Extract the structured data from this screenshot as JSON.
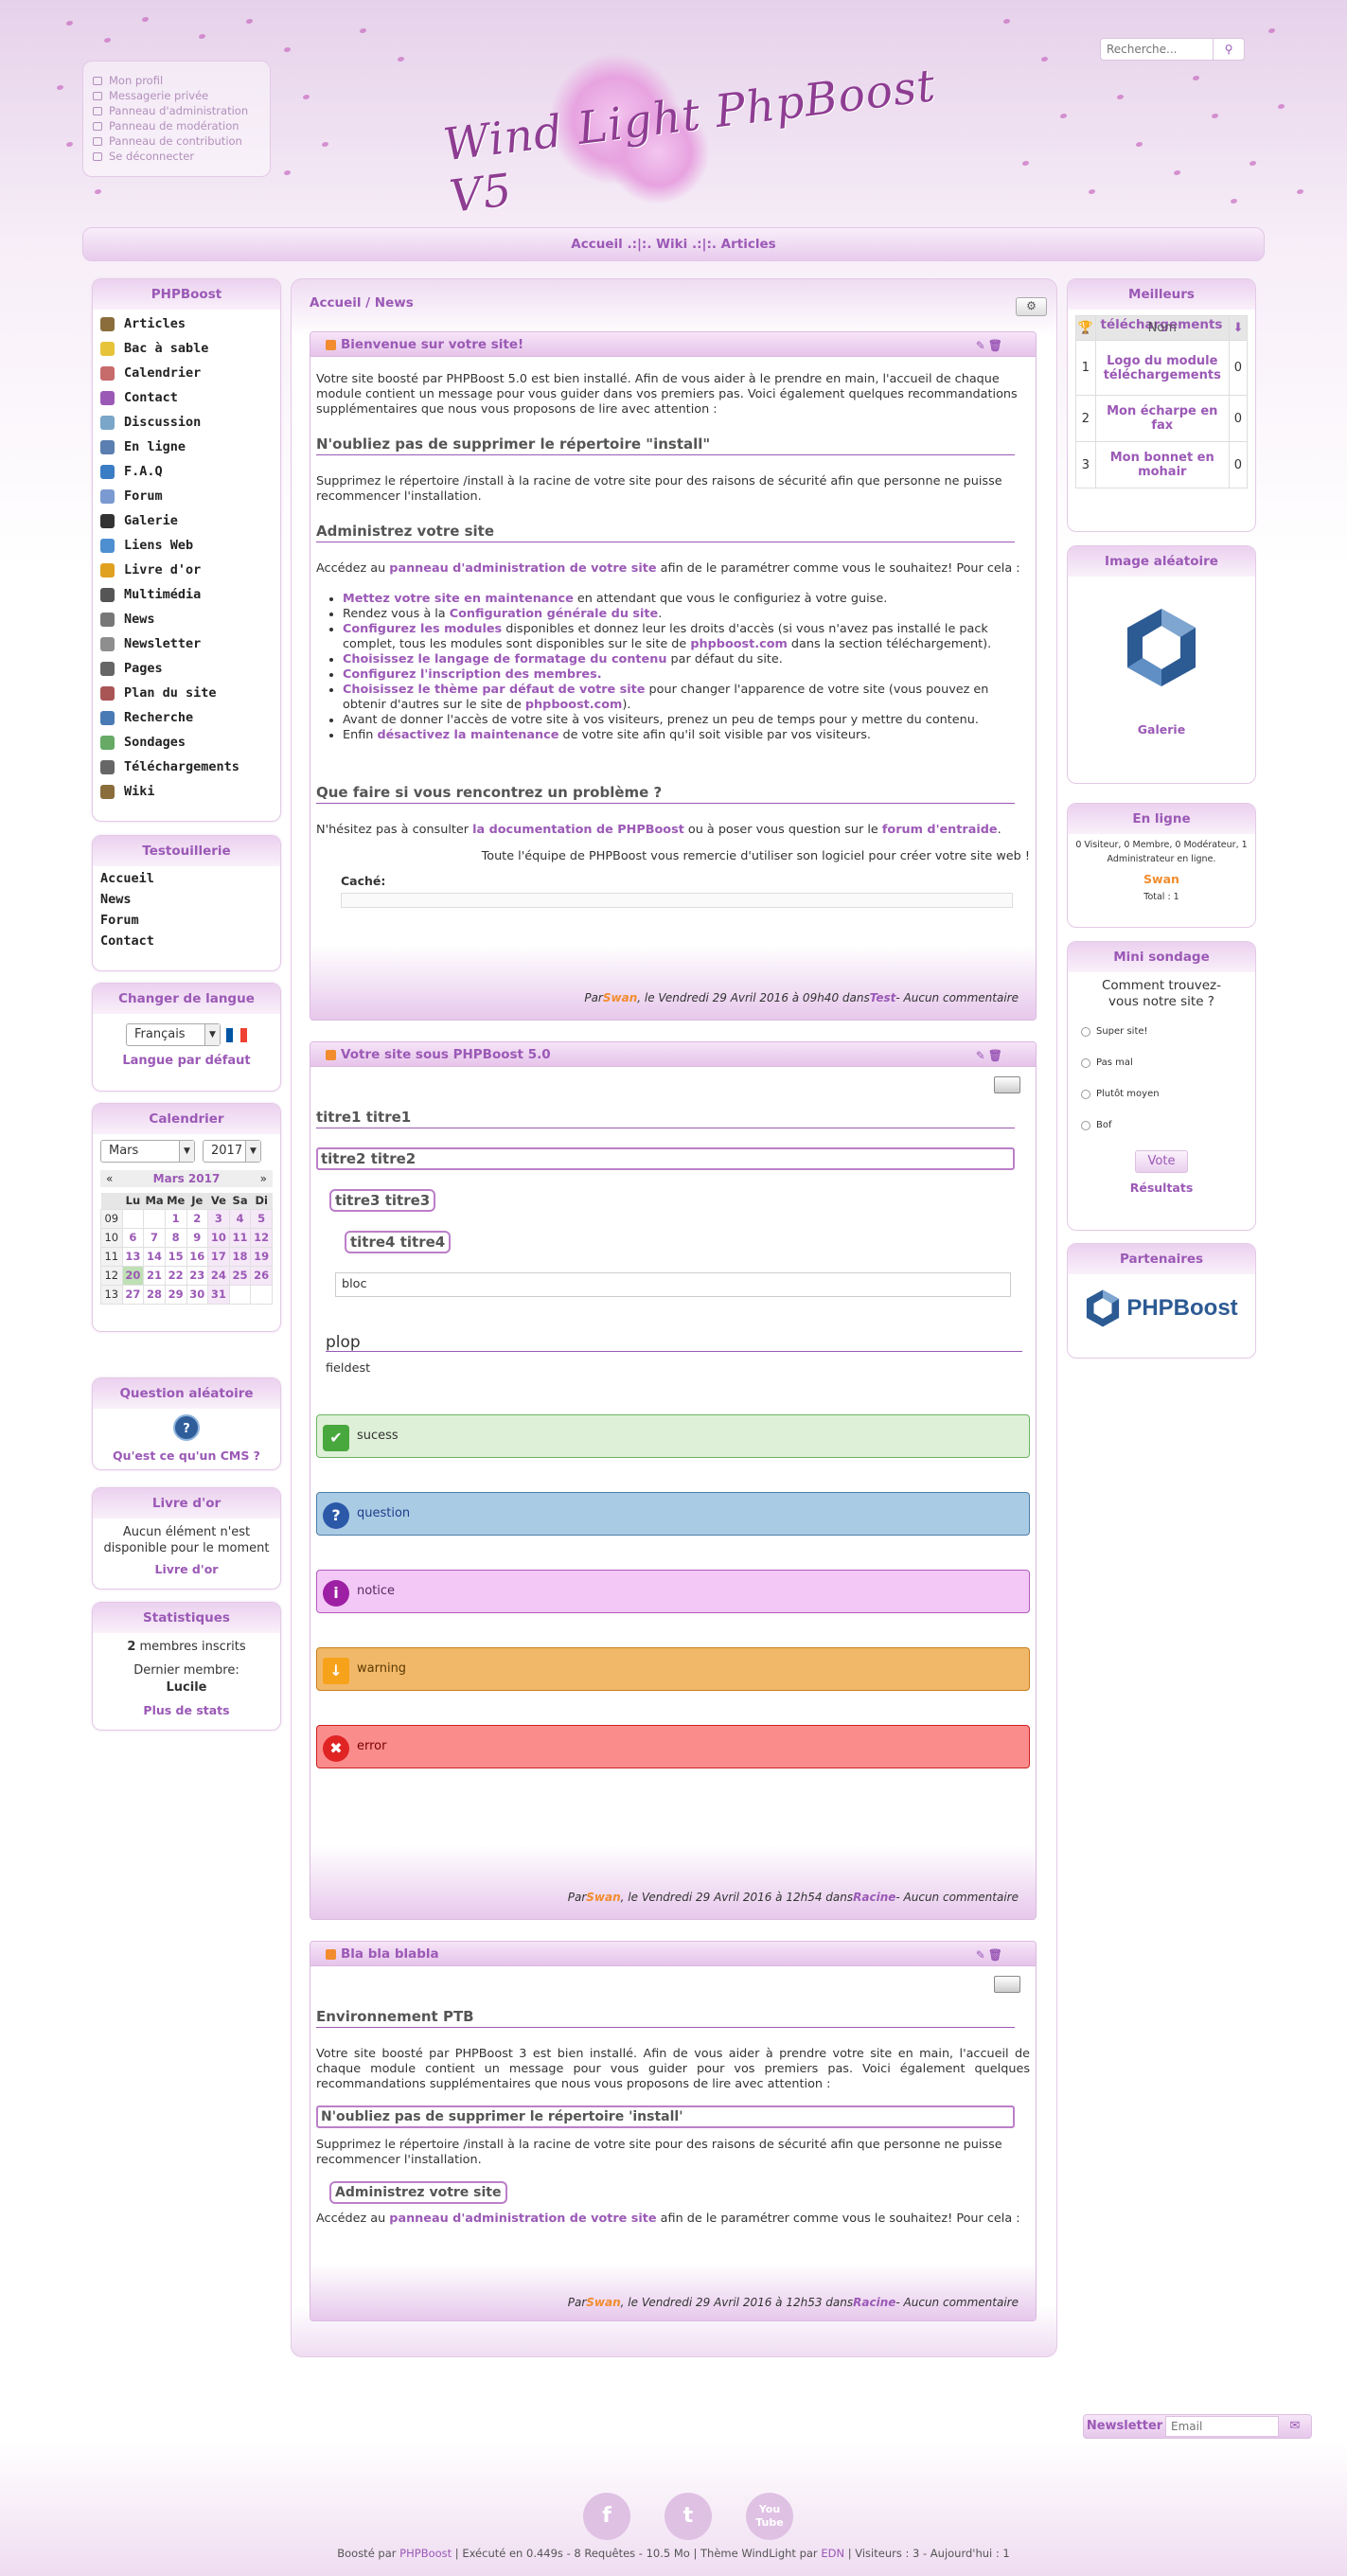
{
  "user_menu": [
    "Mon profil",
    "Messagerie privée",
    "Panneau d'administration",
    "Panneau de modération",
    "Panneau de contribution",
    "Se déconnecter"
  ],
  "logo_text": "Wind Light PhpBoost V5",
  "search": {
    "placeholder": "Recherche...",
    "icon": "search-icon"
  },
  "topbar": "Accueil .:|:. Wiki .:|:. Articles",
  "left": {
    "phpboost_title": "PHPBoost",
    "nav": [
      "Articles",
      "Bac à sable",
      "Calendrier",
      "Contact",
      "Discussion",
      "En ligne",
      "F.A.Q",
      "Forum",
      "Galerie",
      "Liens Web",
      "Livre d'or",
      "Multimédia",
      "News",
      "Newsletter",
      "Pages",
      "Plan du site",
      "Recherche",
      "Sondages",
      "Téléchargements",
      "Wiki"
    ],
    "testouillerie_title": "Testouillerie",
    "testouillerie": [
      "Accueil",
      "News",
      "Forum",
      "Contact"
    ],
    "lang_title": "Changer de langue",
    "lang_value": "Français",
    "lang_default": "Langue par défaut",
    "cal_title": "Calendrier",
    "cal_month": "Mars",
    "cal_year": "2017",
    "cal_prev": "«",
    "cal_next": "»",
    "cal_label": "Mars 2017",
    "cal_days": [
      "Lu",
      "Ma",
      "Me",
      "Je",
      "Ve",
      "Sa",
      "Di"
    ],
    "cal_weeks": [
      [
        "09",
        "",
        "",
        "1",
        "2",
        "3",
        "4",
        "5"
      ],
      [
        "10",
        "6",
        "7",
        "8",
        "9",
        "10",
        "11",
        "12"
      ],
      [
        "11",
        "13",
        "14",
        "15",
        "16",
        "17",
        "18",
        "19"
      ],
      [
        "12",
        "20",
        "21",
        "22",
        "23",
        "24",
        "25",
        "26"
      ],
      [
        "13",
        "27",
        "28",
        "29",
        "30",
        "31",
        "",
        ""
      ]
    ],
    "q_title": "Question aléatoire",
    "q_text": "Qu'est ce qu'un CMS ?",
    "guest_title": "Livre d'or",
    "guest_text": "Aucun élément n'est disponible pour le moment",
    "guest_link": "Livre d'or",
    "stats_title": "Statistiques",
    "stats_members_count": "2",
    "stats_members_label": "membres inscrits",
    "stats_last_label": "Dernier membre:",
    "stats_last_name": "Lucile",
    "stats_more": "Plus de stats"
  },
  "center": {
    "breadcrumb": "Accueil / News",
    "a1": {
      "title": "Bienvenue sur votre site!",
      "p1": "Votre site boosté par PHPBoost 5.0 est bien installé. Afin de vous aider à le prendre en main, l'accueil de chaque module contient un message pour vous guider dans vos premiers pas. Voici également quelques recommandations supplémentaires que nous vous proposons de lire avec attention :",
      "h_install": "N'oubliez pas de supprimer le répertoire \"install\"",
      "p_install": "Supprimez le répertoire /install à la racine de votre site pour des raisons de sécurité afin que personne ne puisse recommencer l'installation.",
      "h_admin": "Administrez votre site",
      "p_admin_a": "Accédez au ",
      "p_admin_link": "panneau d'administration de votre site",
      "p_admin_b": " afin de le paramétrer comme vous le souhaitez! Pour cela :",
      "li1_link": "Mettez votre site en maintenance",
      "li1_text": " en attendant que vous le configuriez à votre guise.",
      "li2_text": "Rendez vous à la ",
      "li2_link": "Configuration générale du site",
      "li3_link": "Configurez les modules",
      "li3_text": " disponibles et donnez leur les droits d'accès (si vous n'avez pas installé le pack complet, tous les modules sont disponibles sur le site de ",
      "li3_link2": "phpboost.com",
      "li3_text2": " dans la section téléchargement).",
      "li4_link": "Choisissez le langage de formatage du contenu",
      "li4_text": " par défaut du site.",
      "li5_link": "Configurez l'inscription des membres.",
      "li6_link": "Choisissez le thème par défaut de votre site",
      "li6_text": " pour changer l'apparence de votre site (vous pouvez en obtenir d'autres sur le site de ",
      "li6_link2": "phpboost.com",
      "li6_text2": ").",
      "li7_text": "Avant de donner l'accès de votre site à vos visiteurs, prenez un peu de temps pour y mettre du contenu.",
      "li8_text": "Enfin ",
      "li8_link": "désactivez la maintenance",
      "li8_text2": " de votre site afin qu'il soit visible par vos visiteurs.",
      "h_problem": "Que faire si vous rencontrez un problème ?",
      "p_problem_a": "N'hésitez pas à consulter ",
      "p_problem_link": "la documentation de PHPBoost",
      "p_problem_b": " ou à poser vous question sur le ",
      "p_problem_link2": "forum d'entraide",
      "p_problem_c": ".",
      "thanks": "Toute l'équipe de PHPBoost vous remercie d'utiliser son logiciel pour créer votre site web !",
      "hidden": "Caché:",
      "footer_a": "Par ",
      "footer_author": "Swan",
      "footer_b": ", le Vendredi 29 Avril 2016 à 09h40 dans ",
      "footer_cat": "Test",
      "footer_c": " - Aucun commentaire"
    },
    "a2": {
      "title": "Votre site sous PHPBoost 5.0",
      "t1": "titre1 titre1",
      "t2": "titre2 titre2",
      "t3": "titre3 titre3",
      "t4": "titre4 titre4",
      "bloc": "bloc",
      "plop": "plop",
      "fieldset": "fieldest",
      "success": "sucess",
      "question": "question",
      "notice": "notice",
      "warning": "warning",
      "error": "error",
      "footer_a": "Par ",
      "footer_author": "Swan",
      "footer_b": ", le Vendredi 29 Avril 2016 à 12h54 dans ",
      "footer_cat": "Racine",
      "footer_c": " - Aucun commentaire"
    },
    "a3": {
      "title": "Bla bla blabla",
      "h_env": "Environnement PTB",
      "p1": "Votre site boosté par PHPBoost 3 est bien installé. Afin de vous aider à prendre votre site en main, l'accueil de chaque module contient un message pour vous guider pour vos premiers pas. Voici également quelques recommandations supplémentaires que nous vous proposons de lire avec attention :",
      "h_install": "N'oubliez pas de supprimer le répertoire 'install'",
      "p_install": "Supprimez le répertoire /install à la racine de votre site pour des raisons de sécurité afin que personne ne puisse recommencer l'installation.",
      "h_admin": "Administrez votre site",
      "p_admin_a": "Accédez au ",
      "p_admin_link": "panneau d'administration de votre site",
      "p_admin_b": " afin de le paramétrer comme vous le souhaitez! Pour cela :",
      "footer_a": "Par ",
      "footer_author": "Swan",
      "footer_b": ", le Vendredi 29 Avril 2016 à 12h53 dans ",
      "footer_cat": "Racine",
      "footer_c": " - Aucun commentaire"
    }
  },
  "right": {
    "dl_title": "Meilleurs téléchargements",
    "dl_col_name": "Nom",
    "dl_rows": [
      [
        "1",
        "Logo du module téléchargements",
        "0"
      ],
      [
        "2",
        "Mon écharpe en fax",
        "0"
      ],
      [
        "3",
        "Mon bonnet en mohair",
        "0"
      ]
    ],
    "img_title": "Image aléatoire",
    "img_link": "Galerie",
    "online_title": "En ligne",
    "online_text": "0 Visiteur, 0 Membre, 0 Modérateur, 1 Administrateur en ligne.",
    "online_user": "Swan",
    "online_total": "Total : 1",
    "poll_title": "Mini sondage",
    "poll_question": "Comment trouvez-vous notre site ?",
    "poll_options": [
      "Super site!",
      "Pas mal",
      "Plutôt moyen",
      "Bof"
    ],
    "poll_vote": "Vote",
    "poll_results": "Résultats",
    "partners_title": "Partenaires",
    "partners_logo": "PHPBoost"
  },
  "newsletter": {
    "label": "Newsletter",
    "placeholder": "Email"
  },
  "social": [
    "f",
    "t",
    "You Tube"
  ],
  "footer": {
    "a": "Boosté par ",
    "link1": "PHPBoost",
    "b": " | Exécuté en 0.449s - 8 Requêtes - 10.5 Mo | Thème WindLight par ",
    "link2": "EDN",
    "c": " | Visiteurs : 3 - Aujourd'hui : 1"
  },
  "colors": {
    "accent": "#9b59b6",
    "orange": "#f28c2e",
    "success_bg": "#dff0d8",
    "question_bg": "#aacbe4",
    "notice_bg": "#f3c8f7",
    "warning_bg": "#f2b869",
    "error_bg": "#fb8c8c"
  }
}
